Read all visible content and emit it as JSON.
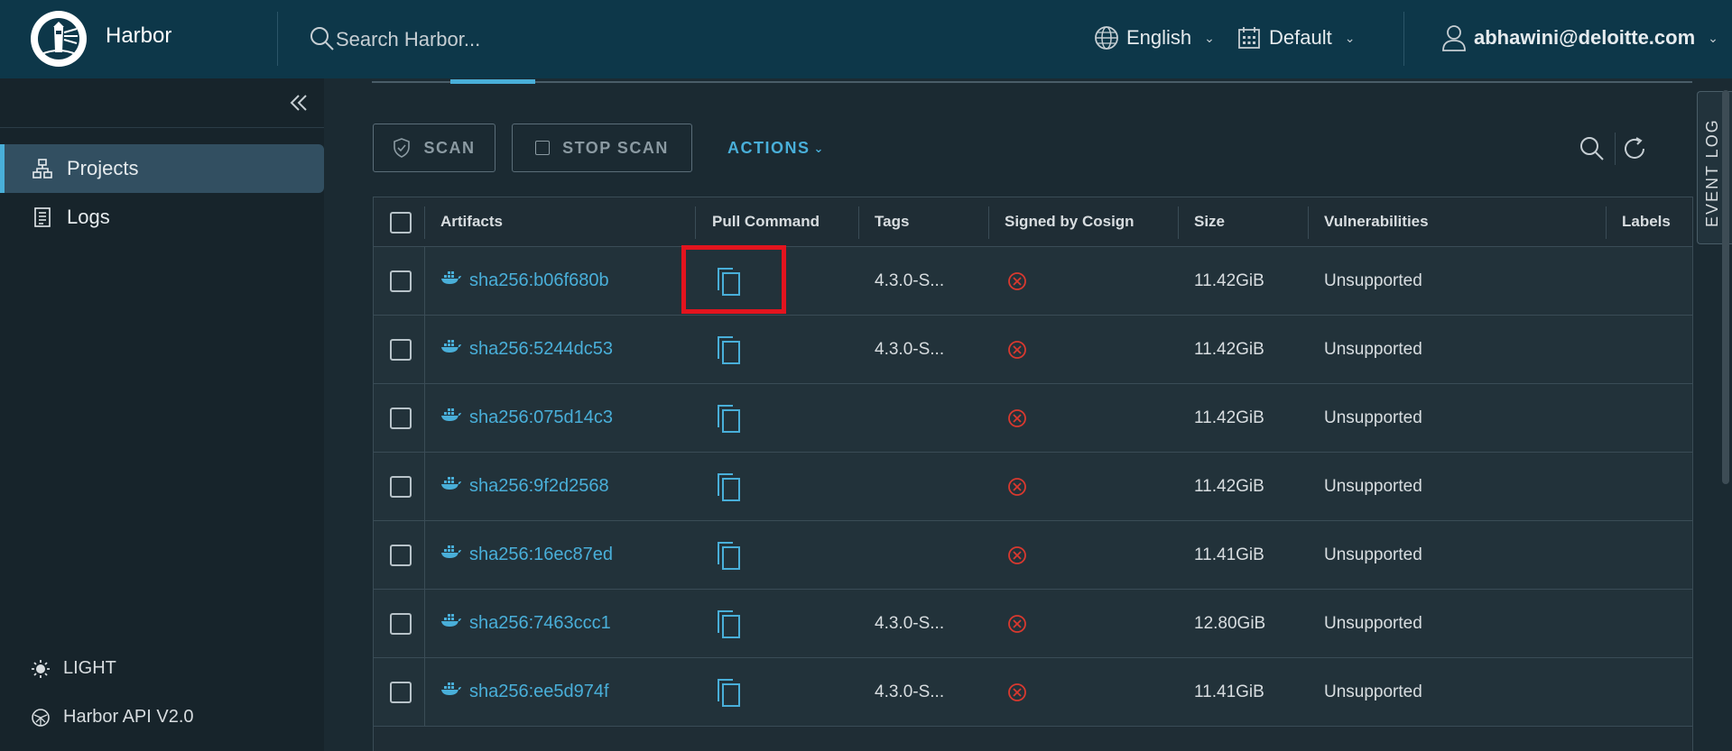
{
  "header": {
    "app_title": "Harbor",
    "search_placeholder": "Search Harbor...",
    "language": "English",
    "theme_profile": "Default",
    "user": "abhawini@deloitte.com"
  },
  "sidebar": {
    "items": [
      {
        "label": "Projects",
        "icon": "projects-icon",
        "active": true
      },
      {
        "label": "Logs",
        "icon": "logs-icon",
        "active": false
      }
    ],
    "footer": {
      "theme_label": "LIGHT",
      "api_label": "Harbor API V2.0"
    }
  },
  "toolbar": {
    "scan_label": "SCAN",
    "stop_scan_label": "STOP SCAN",
    "actions_label": "ACTIONS"
  },
  "event_log_label": "EVENT LOG",
  "table": {
    "columns": [
      "Artifacts",
      "Pull Command",
      "Tags",
      "Signed by Cosign",
      "Size",
      "Vulnerabilities",
      "Labels"
    ],
    "rows": [
      {
        "artifact": "sha256:b06f680b",
        "tags": "4.3.0-S...",
        "size": "11.42GiB",
        "vulnerabilities": "Unsupported"
      },
      {
        "artifact": "sha256:5244dc53",
        "tags": "4.3.0-S...",
        "size": "11.42GiB",
        "vulnerabilities": "Unsupported"
      },
      {
        "artifact": "sha256:075d14c3",
        "tags": "",
        "size": "11.42GiB",
        "vulnerabilities": "Unsupported"
      },
      {
        "artifact": "sha256:9f2d2568",
        "tags": "",
        "size": "11.42GiB",
        "vulnerabilities": "Unsupported"
      },
      {
        "artifact": "sha256:16ec87ed",
        "tags": "",
        "size": "11.41GiB",
        "vulnerabilities": "Unsupported"
      },
      {
        "artifact": "sha256:7463ccc1",
        "tags": "4.3.0-S...",
        "size": "12.80GiB",
        "vulnerabilities": "Unsupported"
      },
      {
        "artifact": "sha256:ee5d974f",
        "tags": "4.3.0-S...",
        "size": "11.41GiB",
        "vulnerabilities": "Unsupported"
      }
    ]
  },
  "colors": {
    "header_bg": "#0d3749",
    "accent": "#49afd9",
    "highlight": "#e3141e",
    "unsigned": "#d9392f"
  }
}
